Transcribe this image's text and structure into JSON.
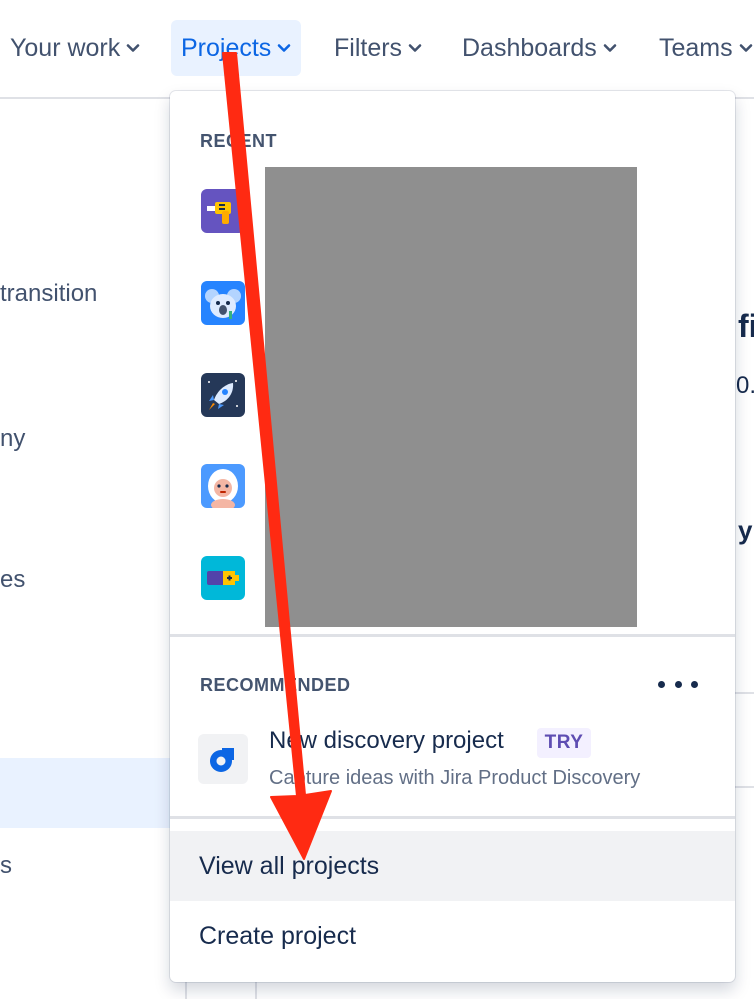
{
  "nav": {
    "items": [
      {
        "label": "Your work"
      },
      {
        "label": "Projects"
      },
      {
        "label": "Filters"
      },
      {
        "label": "Dashboards"
      },
      {
        "label": "Teams"
      }
    ]
  },
  "background": {
    "fragments": [
      "transition",
      "ny",
      "es",
      "s",
      "fi",
      "0.",
      "y"
    ]
  },
  "dropdown": {
    "recent_title": "RECENT",
    "recent_icons": [
      "drill-project-icon",
      "koala-project-icon",
      "rocket-project-icon",
      "yeti-project-icon",
      "battery-project-icon"
    ],
    "recommended_title": "RECOMMENDED",
    "recommended_item": {
      "title": "New discovery project",
      "badge": "TRY",
      "description": "Capture ideas with Jira Product Discovery"
    },
    "view_all_label": "View all projects",
    "create_label": "Create project"
  },
  "colors": {
    "accent": "#0c66e4",
    "arrow": "#ff2a12",
    "redaction": "#8f8f8f",
    "badge_text": "#5e4db2"
  }
}
